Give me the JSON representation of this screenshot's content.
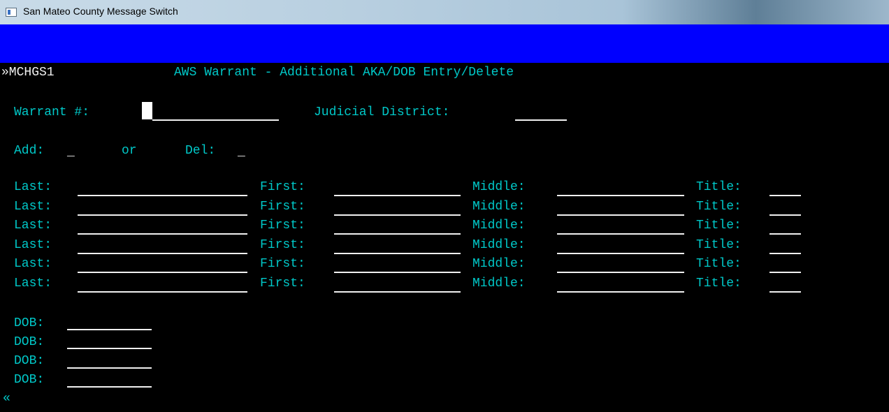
{
  "window": {
    "title": "San Mateo County Message Switch"
  },
  "screen": {
    "screen_id": "»MCHGS1",
    "heading": "AWS Warrant - Additional AKA/DOB Entry/Delete",
    "warrant_label": "Warrant #:",
    "warrant_value": "",
    "judicial_label": "Judicial District:",
    "judicial_value": "",
    "add_label": "Add:",
    "add_value": "_",
    "or_label": "or",
    "del_label": "Del:",
    "del_value": "_",
    "name_rows": [
      {
        "last": "Last:",
        "first": "First:",
        "middle": "Middle:",
        "title": "Title:"
      },
      {
        "last": "Last:",
        "first": "First:",
        "middle": "Middle:",
        "title": "Title:"
      },
      {
        "last": "Last:",
        "first": "First:",
        "middle": "Middle:",
        "title": "Title:"
      },
      {
        "last": "Last:",
        "first": "First:",
        "middle": "Middle:",
        "title": "Title:"
      },
      {
        "last": "Last:",
        "first": "First:",
        "middle": "Middle:",
        "title": "Title:"
      },
      {
        "last": "Last:",
        "first": "First:",
        "middle": "Middle:",
        "title": "Title:"
      }
    ],
    "dob_rows": [
      {
        "label": "DOB:"
      },
      {
        "label": "DOB:"
      },
      {
        "label": "DOB:"
      },
      {
        "label": "DOB:"
      }
    ],
    "end_marker": "«"
  },
  "colors": {
    "text": "#00c8c8",
    "field": "#f0f0f0",
    "banner": "#0000ff",
    "background": "#000000"
  },
  "icons": {
    "window": "app-window-icon"
  }
}
